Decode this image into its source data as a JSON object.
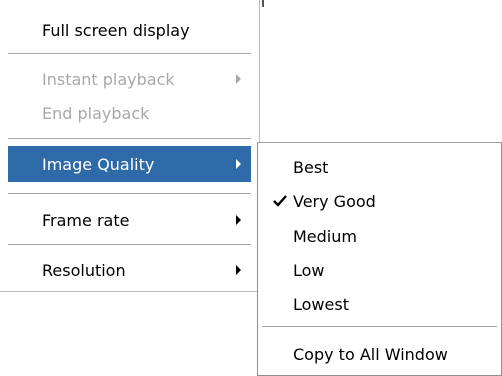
{
  "main_menu": {
    "items": [
      {
        "label": "Full screen display",
        "enabled": true,
        "submenu": false
      },
      {
        "label": "Instant playback",
        "enabled": false,
        "submenu": true
      },
      {
        "label": "End playback",
        "enabled": false,
        "submenu": false
      },
      {
        "label": "Image Quality",
        "enabled": true,
        "submenu": true,
        "highlighted": true
      },
      {
        "label": "Frame rate",
        "enabled": true,
        "submenu": true
      },
      {
        "label": "Resolution",
        "enabled": true,
        "submenu": true
      }
    ]
  },
  "image_quality_menu": {
    "items": [
      {
        "label": "Best",
        "checked": false
      },
      {
        "label": "Very Good",
        "checked": true
      },
      {
        "label": "Medium",
        "checked": false
      },
      {
        "label": "Low",
        "checked": false
      },
      {
        "label": "Lowest",
        "checked": false
      },
      {
        "label": "Copy to All Window",
        "checked": false
      }
    ]
  },
  "colors": {
    "highlight": "#2f6aa8",
    "disabled_text": "#a8a8a8"
  }
}
